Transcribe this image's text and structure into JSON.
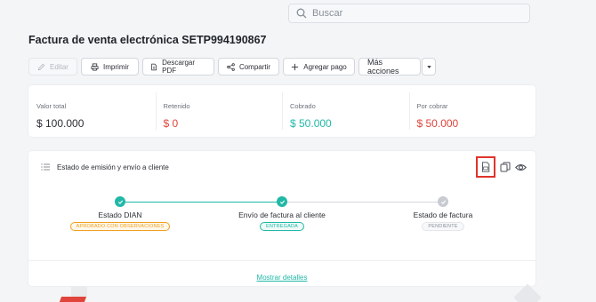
{
  "search": {
    "placeholder": "Buscar"
  },
  "page": {
    "title": "Factura de venta electrónica SETP994190867"
  },
  "toolbar": {
    "edit": "Editar",
    "print": "Imprimir",
    "download": "Descargar PDF",
    "share": "Compartir",
    "add_payment": "Agregar pago",
    "more": "Más acciones"
  },
  "summary": [
    {
      "label": "Valor total",
      "value": "$ 100.000",
      "color": "#2b2f36"
    },
    {
      "label": "Retenido",
      "value": "$ 0",
      "color": "#e0443a"
    },
    {
      "label": "Cobrado",
      "value": "$ 50.000",
      "color": "#21b8a7"
    },
    {
      "label": "Por cobrar",
      "value": "$ 50.000",
      "color": "#e0443a"
    }
  ],
  "status_card": {
    "title": "Estado de emisión y envío a cliente",
    "icons": [
      "document-pdf-icon",
      "copy-icon",
      "eye-icon"
    ],
    "steps": [
      {
        "name": "Estado DIAN",
        "badge": "APROBADO CON OBSERVACIONES",
        "state": "done",
        "badge_color": "#f0a020"
      },
      {
        "name": "Envío de factura al cliente",
        "badge": "ENTREGADA",
        "state": "done",
        "badge_color": "#21b8a7"
      },
      {
        "name": "Estado de factura",
        "badge": "PENDIENTE",
        "state": "pending",
        "badge_color": "#8a9099"
      }
    ],
    "details_link": "Mostrar detalles"
  },
  "colors": {
    "accent": "#21b8a7",
    "danger": "#e0443a",
    "warning": "#f0a020",
    "highlight": "#e0332b"
  }
}
